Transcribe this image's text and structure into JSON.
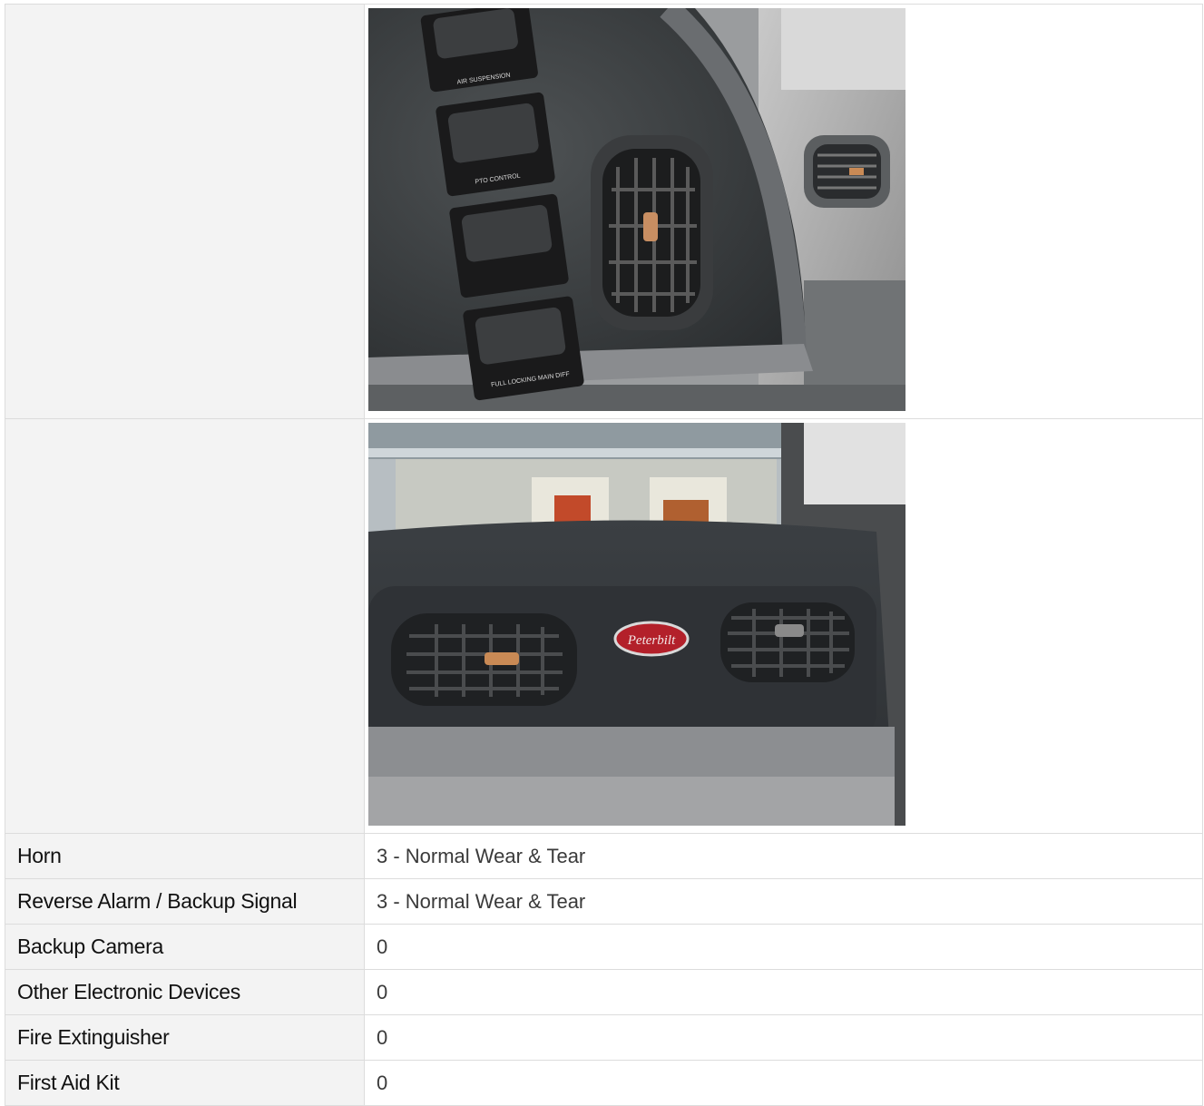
{
  "photos": [
    {
      "name": "Dash switch panel with air suspension, PTO control and locking switches beside vertical air vent"
    },
    {
      "name": "Dashboard with two air vents and Peterbilt emblem"
    }
  ],
  "photo_text": {
    "air_suspension": "AIR SUSPENSION",
    "pto_control": "PTO CONTROL",
    "full_locking": "FULL LOCKING MAIN DIFF",
    "brand": "Peterbilt"
  },
  "rows": [
    {
      "label": "Horn",
      "value": "3 - Normal Wear & Tear"
    },
    {
      "label": "Reverse Alarm / Backup Signal",
      "value": "3 - Normal Wear & Tear"
    },
    {
      "label": "Backup Camera",
      "value": "0"
    },
    {
      "label": "Other Electronic Devices",
      "value": "0"
    },
    {
      "label": "Fire Extinguisher",
      "value": "0"
    },
    {
      "label": "First Aid Kit",
      "value": "0"
    }
  ],
  "colors": {
    "label_bg": "#f3f3f3",
    "border": "#dcdcdc",
    "emblem_red": "#b3202a"
  }
}
